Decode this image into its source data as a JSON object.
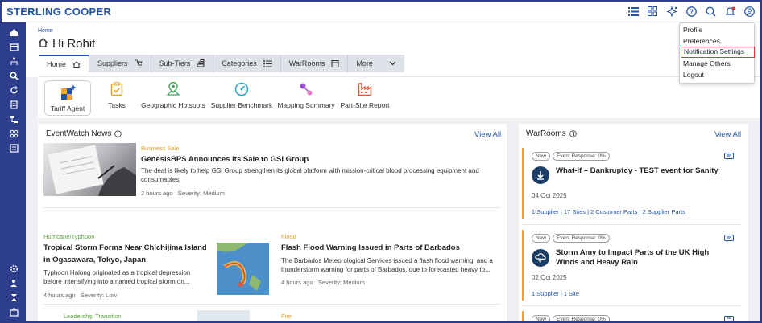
{
  "app": {
    "brand": "STERLING COOPER"
  },
  "topbar": {
    "icons": [
      "list-icon",
      "grid-icon",
      "sparkle-icon",
      "help-icon",
      "search-icon",
      "notification-icon",
      "user-icon"
    ]
  },
  "user_menu": {
    "items": [
      "Profile",
      "Preferences",
      "Notification Settings",
      "Manage Others",
      "Logout"
    ],
    "highlighted": "Notification Settings"
  },
  "breadcrumb": "Home",
  "greeting": "Hi Rohit",
  "tabs": [
    "Home",
    "Suppliers",
    "Sub-Tiers",
    "Categories",
    "WarRooms",
    "More"
  ],
  "quick_actions": [
    "Tariff Agent",
    "Tasks",
    "Geographic Hotspots",
    "Supplier Benchmark",
    "Mapping Summary",
    "Part-Site Report"
  ],
  "eventwatch": {
    "title": "EventWatch News",
    "view_all": "View All",
    "items": [
      {
        "category": "Business Sale",
        "headline": "GenesisBPS Announces its Sale to GSI Group",
        "body": "The deal is likely to help GSI Group strengthen its global platform with mission-critical blood processing equipment and consumables.",
        "time": "2 hours ago",
        "severity": "Severity: Medium"
      },
      {
        "category": "Hurricane/Typhoon",
        "headline": "Tropical Storm Forms Near Chichijima Island in Ogasawara, Tokyo, Japan",
        "body": "Typhoon Halong originated as a tropical depression before intensifying into a named tropical storm on...",
        "time": "4 hours ago",
        "severity": "Severity: Low"
      },
      {
        "category": "Flood",
        "headline": "Flash Flood Warning Issued in Parts of Barbados",
        "body": "The Barbados Meteorological Services issued a flash flood warning, and a thunderstorm warning for parts of Barbados, due to forecasted heavy to...",
        "time": "4 hours ago",
        "severity": "Severity: Medium"
      },
      {
        "category": "Leadership Transition"
      },
      {
        "category": "Fire"
      }
    ]
  },
  "warrooms": {
    "title": "WarRooms",
    "view_all": "View All",
    "items": [
      {
        "status": "New",
        "response": "Event Response: 0%",
        "title": "What-If – Bankruptcy - TEST event for Sanity",
        "date": "04 Oct 2025",
        "links": "1 Supplier | 17 Sites | 2 Customer Parts | 2 Supplier Parts"
      },
      {
        "status": "New",
        "response": "Event Response: 0%",
        "title": "Storm Amy to Impact Parts of the UK High Winds and Heavy Rain",
        "date": "02 Oct 2025",
        "links": "1 Supplier | 1 Site"
      },
      {
        "status": "New",
        "response": "Event Response: 0%"
      }
    ]
  },
  "colors": {
    "brand": "#2152a8",
    "sidebar": "#2d3e8c",
    "category_green": "#5aa33a",
    "category_orange": "#e0a020",
    "highlight": "#d93a36"
  }
}
